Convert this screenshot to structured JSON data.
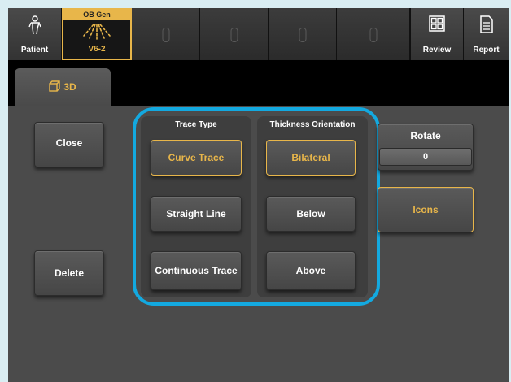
{
  "topbar": {
    "patient_label": "Patient",
    "probe_header": "OB Gen",
    "probe_label": "V6-2",
    "review_label": "Review",
    "report_label": "Report",
    "empty_slots": 4
  },
  "tab": {
    "label": "3D"
  },
  "buttons": {
    "close": "Close",
    "delete": "Delete",
    "rotate_label": "Rotate",
    "rotate_value": "0",
    "icons": "Icons"
  },
  "trace_type": {
    "header": "Trace Type",
    "options": [
      "Curve Trace",
      "Straight Line",
      "Continuous Trace"
    ],
    "selected": "Curve Trace"
  },
  "thickness_orientation": {
    "header": "Thickness Orientation",
    "options": [
      "Bilateral",
      "Below",
      "Above"
    ],
    "selected": "Bilateral"
  },
  "colors": {
    "accent": "#e8b64a",
    "highlight": "#13a9e0",
    "panel": "#4b4b4b",
    "background": "#d9edf2"
  }
}
